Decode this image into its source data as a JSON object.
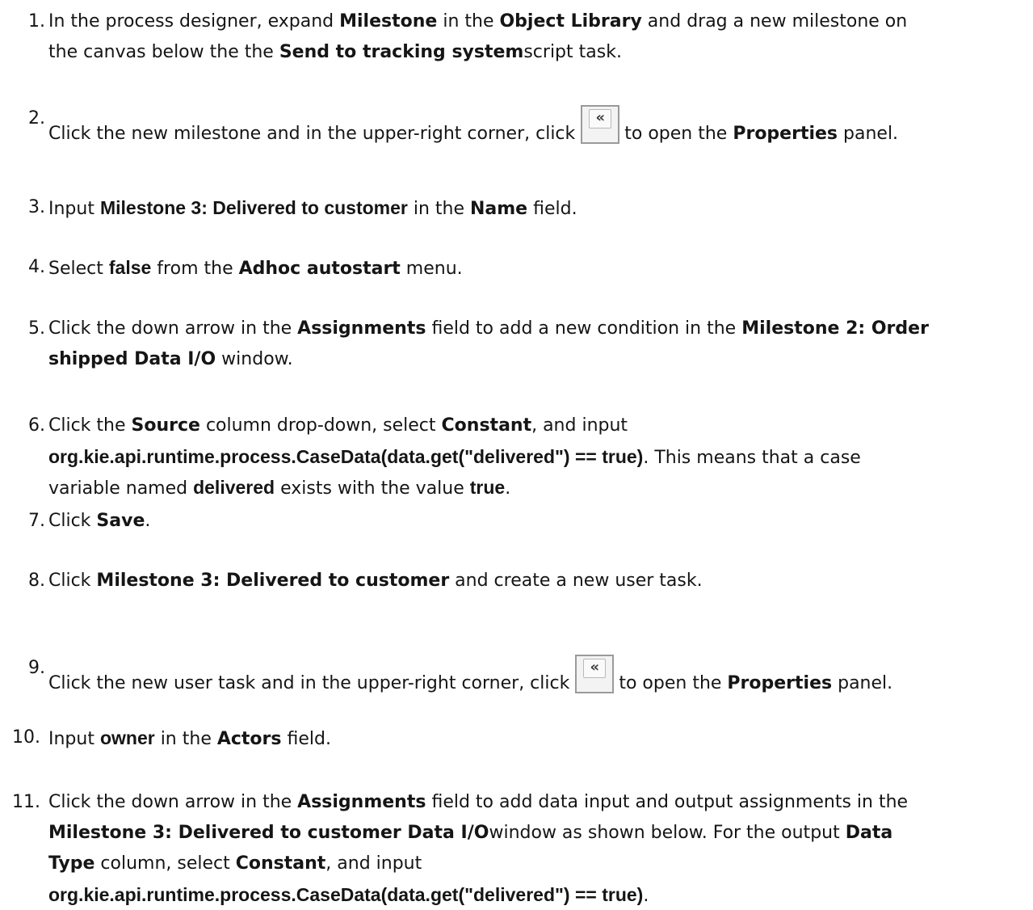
{
  "steps": [
    {
      "num": "1.",
      "lines": [
        [
          {
            "t": "In the process designer, expand ",
            "s": "n"
          },
          {
            "t": "Milestone",
            "s": "b"
          },
          {
            "t": " in the  ",
            "s": "n"
          },
          {
            "t": "Object Library",
            "s": "b"
          },
          {
            "t": " and drag a new milestone on",
            "s": "n"
          }
        ],
        [
          {
            "t": "the canvas below the the ",
            "s": "n"
          },
          {
            "t": "Send to tracking system",
            "s": "b"
          },
          {
            "t": "script task.",
            "s": "n"
          }
        ]
      ]
    },
    {
      "num": "2.",
      "lines": [
        [
          {
            "t": "Click the new milestone and in the upper-right corner, click ",
            "s": "n"
          },
          {
            "t": "«",
            "s": "btn",
            "icon": "collapse-panel-icon"
          },
          {
            "t": "to open the ",
            "s": "n"
          },
          {
            "t": "Properties",
            "s": "b"
          },
          {
            "t": " panel.",
            "s": "n"
          }
        ]
      ]
    },
    {
      "num": "3.",
      "lines": [
        [
          {
            "t": "Input ",
            "s": "n"
          },
          {
            "t": "Milestone 3: Delivered to customer",
            "s": "lit"
          },
          {
            "t": " in the  ",
            "s": "n"
          },
          {
            "t": "Name",
            "s": "b"
          },
          {
            "t": " field.",
            "s": "n"
          }
        ]
      ]
    },
    {
      "num": "4.",
      "lines": [
        [
          {
            "t": "Select ",
            "s": "n"
          },
          {
            "t": "false",
            "s": "lit"
          },
          {
            "t": " from the  ",
            "s": "n"
          },
          {
            "t": "Adhoc autostart",
            "s": "b"
          },
          {
            "t": " menu.",
            "s": "n"
          }
        ]
      ]
    },
    {
      "num": "5.",
      "lines": [
        [
          {
            "t": "Click the down arrow in the ",
            "s": "n"
          },
          {
            "t": "Assignments",
            "s": "b"
          },
          {
            "t": " field to add a new condition in the   ",
            "s": "n"
          },
          {
            "t": "Milestone 2: Order",
            "s": "b"
          }
        ],
        [
          {
            "t": "shipped Data I/O",
            "s": "b"
          },
          {
            "t": " window.",
            "s": "n"
          }
        ]
      ]
    },
    {
      "num": "6.",
      "lines": [
        [
          {
            "t": "Click the ",
            "s": "n"
          },
          {
            "t": "Source",
            "s": "b"
          },
          {
            "t": " column drop-down, select  ",
            "s": "n"
          },
          {
            "t": "Constant",
            "s": "b"
          },
          {
            "t": ", and input",
            "s": "n"
          }
        ],
        [
          {
            "t": "org.kie.api.runtime.process.CaseData(data.get(\"delivered\") == true)",
            "s": "lit"
          },
          {
            "t": ". This means that a case",
            "s": "n"
          }
        ],
        [
          {
            "t": "variable named ",
            "s": "n"
          },
          {
            "t": "delivered",
            "s": "lit"
          },
          {
            "t": " exists with the value  ",
            "s": "n"
          },
          {
            "t": "true",
            "s": "lit"
          },
          {
            "t": ".",
            "s": "n"
          }
        ]
      ]
    },
    {
      "num": "7.",
      "lines": [
        [
          {
            "t": "Click ",
            "s": "n"
          },
          {
            "t": "Save",
            "s": "b"
          },
          {
            "t": ".",
            "s": "n"
          }
        ]
      ]
    },
    {
      "num": "8.",
      "lines": [
        [
          {
            "t": "Click ",
            "s": "n"
          },
          {
            "t": "Milestone 3: Delivered to customer",
            "s": "b"
          },
          {
            "t": " and create a new user task.",
            "s": "n"
          }
        ]
      ]
    },
    {
      "num": "9.",
      "lines": [
        [
          {
            "t": "Click the new user task and in the upper-right corner, click ",
            "s": "n"
          },
          {
            "t": "«",
            "s": "btn",
            "icon": "collapse-panel-icon"
          },
          {
            "t": "to open the ",
            "s": "n"
          },
          {
            "t": "Properties",
            "s": "b"
          },
          {
            "t": " panel.",
            "s": "n"
          }
        ]
      ]
    },
    {
      "num": "10.",
      "lines": [
        [
          {
            "t": "Input ",
            "s": "n"
          },
          {
            "t": "owner",
            "s": "lit"
          },
          {
            "t": " in the  ",
            "s": "n"
          },
          {
            "t": "Actors",
            "s": "b"
          },
          {
            "t": " field.",
            "s": "n"
          }
        ]
      ]
    },
    {
      "num": "11.",
      "lines": [
        [
          {
            "t": "Click the down arrow in the ",
            "s": "n"
          },
          {
            "t": "Assignments",
            "s": "b"
          },
          {
            "t": " field to add data input and output assignments in the",
            "s": "n"
          }
        ],
        [
          {
            "t": "Milestone 3: Delivered to customer Data I/O",
            "s": "b"
          },
          {
            "t": "window as shown below. For the output  ",
            "s": "n"
          },
          {
            "t": "Data",
            "s": "b"
          }
        ],
        [
          {
            "t": "Type",
            "s": "b"
          },
          {
            "t": " column, select ",
            "s": "n"
          },
          {
            "t": "Constant",
            "s": "b"
          },
          {
            "t": ", and input",
            "s": "n"
          }
        ],
        [
          {
            "t": "org.kie.api.runtime.process.CaseData(data.get(\"delivered\") == true)",
            "s": "lit"
          },
          {
            "t": ".",
            "s": "n"
          }
        ]
      ]
    }
  ]
}
